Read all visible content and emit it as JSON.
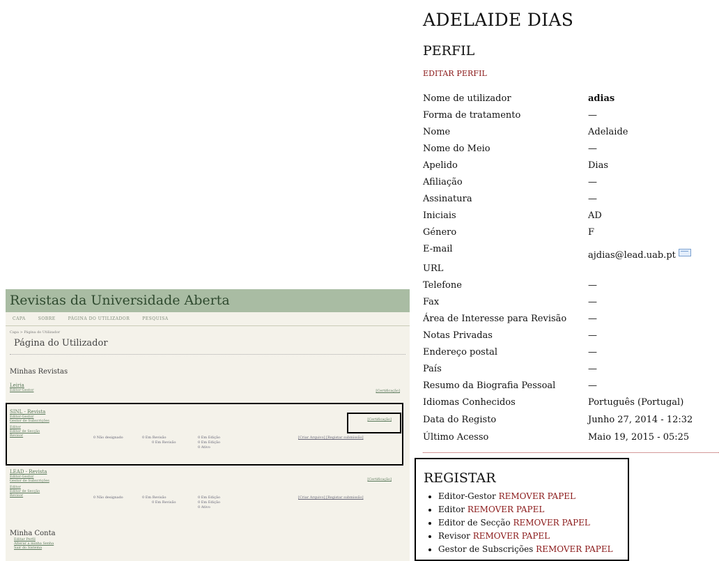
{
  "mini": {
    "site_title": "Revistas da Universidade Aberta",
    "nav": [
      "CAPA",
      "SOBRE",
      "PÁGINA DO UTILIZADOR",
      "PESQUISA"
    ],
    "breadcrumb": "Capa > Página do Utilizador",
    "page_title": "Página do Utilizador",
    "my_journals": "Minhas Revistas",
    "journals": [
      {
        "name": "Leiria",
        "roles": [
          "Editor-Gestor"
        ],
        "status": "[Certificação]"
      },
      {
        "name": "SINL - Revista",
        "roles": [
          "Editor-Gestor",
          "Gestor de Subscrições",
          "Editor",
          "Editor de Secção",
          "Revisor"
        ],
        "status": "[Certificação]",
        "stats": [
          "0 Não designado",
          "0 Em Revisão",
          "0 Em Edição",
          "[Criar Arquivo] [Registar submissão]",
          "0 Em Revisão",
          "0 Em Edição",
          "0 Ativo"
        ]
      },
      {
        "name": "LEAD - Revista",
        "roles": [
          "Editor-Gestor",
          "Gestor de Subscrições",
          "Editor",
          "Editor de Secção",
          "Revisor"
        ],
        "status": "[Certificação]",
        "stats": [
          "0 Não designado",
          "0 Em Revisão",
          "0 Em Edição",
          "[Criar Arquivo] [Registar submissão]",
          "0 Em Revisão",
          "0 Em Edição",
          "0 Ativo"
        ]
      }
    ],
    "my_account": "Minha Conta",
    "account_links": [
      "Editar Perfil",
      "Alterar a minha Senha",
      "Sair do Sistema"
    ]
  },
  "profile": {
    "name": "ADELAIDE DIAS",
    "section": "PERFIL",
    "edit_link": "EDITAR PERFIL",
    "rows": [
      {
        "label": "Nome de utilizador",
        "value": "adias"
      },
      {
        "label": "Forma de tratamento",
        "value": "—"
      },
      {
        "label": "Nome",
        "value": "Adelaide"
      },
      {
        "label": "Nome do Meio",
        "value": "—"
      },
      {
        "label": "Apelido",
        "value": "Dias"
      },
      {
        "label": "Afiliação",
        "value": "—"
      },
      {
        "label": "Assinatura",
        "value": "—"
      },
      {
        "label": "Iniciais",
        "value": "AD"
      },
      {
        "label": "Género",
        "value": "F"
      },
      {
        "label": "E-mail",
        "value": "ajdias@lead.uab.pt"
      },
      {
        "label": "URL",
        "value": ""
      },
      {
        "label": "Telefone",
        "value": "—"
      },
      {
        "label": "Fax",
        "value": "—"
      },
      {
        "label": "Área de Interesse para Revisão",
        "value": "—"
      },
      {
        "label": "Notas Privadas",
        "value": "—"
      },
      {
        "label": "Endereço postal",
        "value": "—"
      },
      {
        "label": "País",
        "value": "—"
      },
      {
        "label": "Resumo da Biografia Pessoal",
        "value": "—"
      },
      {
        "label": "Idiomas Conhecidos",
        "value": "Português (Portugal)"
      },
      {
        "label": "Data do Registo",
        "value": "Junho 27, 2014 - 12:32"
      },
      {
        "label": "Último Acesso",
        "value": "Maio 19, 2015 - 05:25"
      }
    ]
  },
  "roles": {
    "title": "REGISTAR",
    "remove_label": "REMOVER PAPEL",
    "items": [
      "Editor-Gestor",
      "Editor",
      "Editor de Secção",
      "Revisor",
      "Gestor de Subscrições"
    ]
  }
}
